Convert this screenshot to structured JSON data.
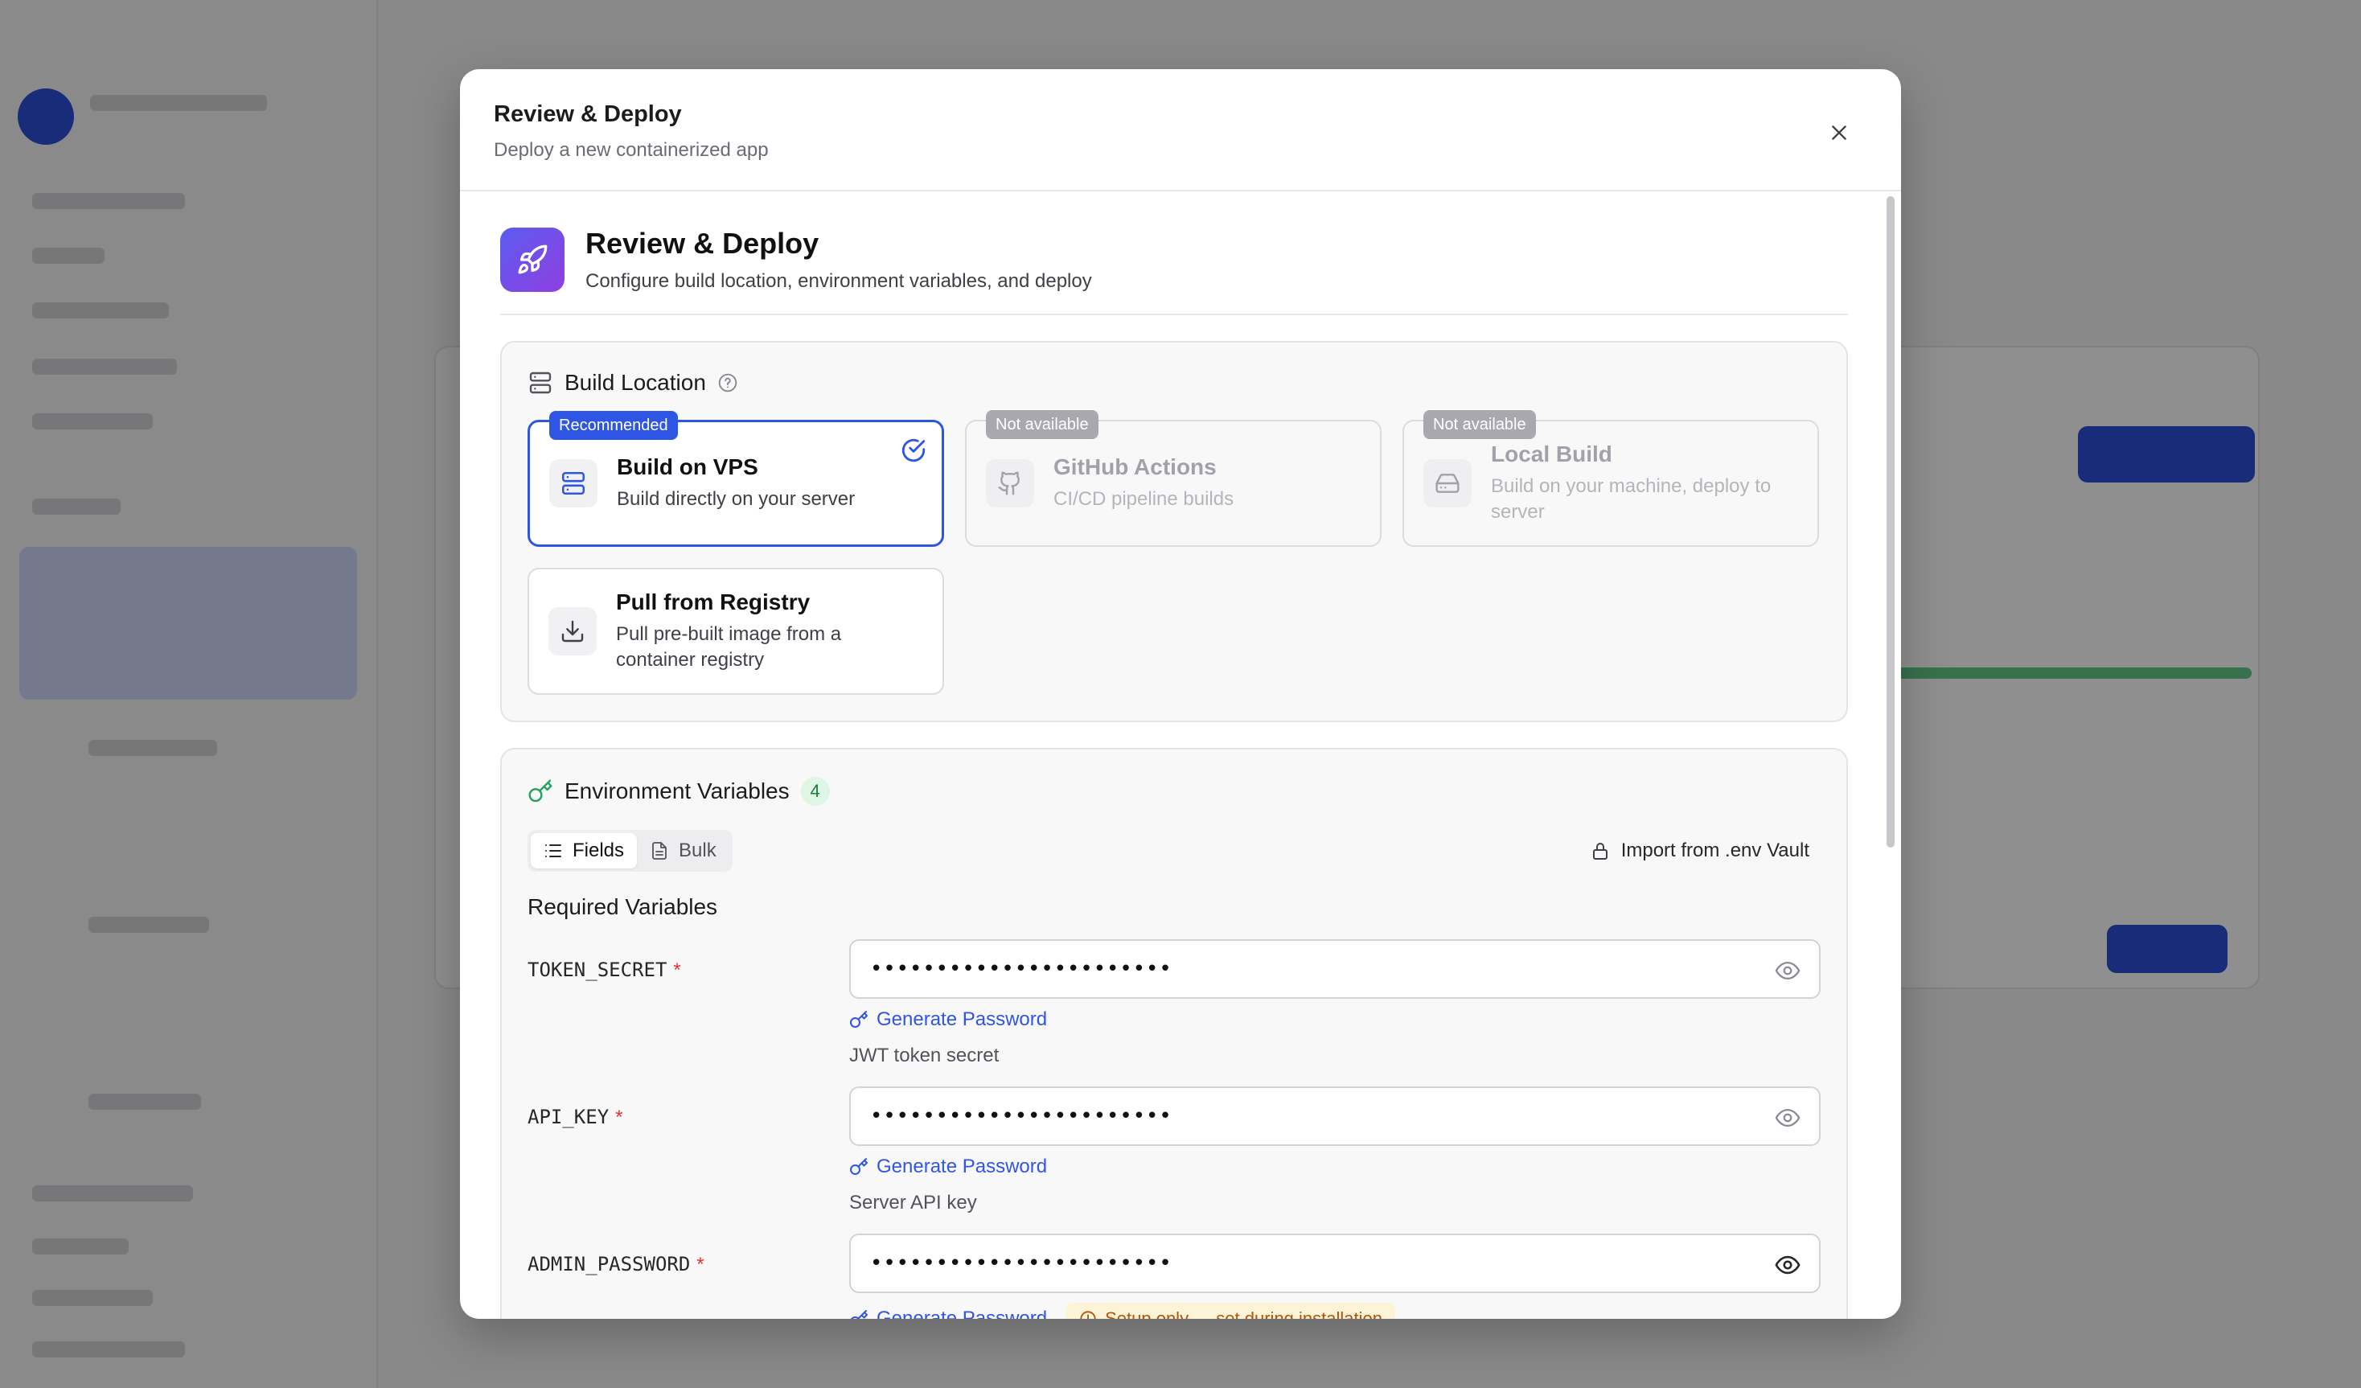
{
  "modal": {
    "title": "Review & Deploy",
    "subtitle": "Deploy a new containerized app"
  },
  "step": {
    "title": "Review & Deploy",
    "description": "Configure build location, environment variables, and deploy"
  },
  "build_location": {
    "heading": "Build Location",
    "options": [
      {
        "name": "Build on VPS",
        "description": "Build directly on your server",
        "tag": "Recommended",
        "selected": true,
        "icon": "server-icon"
      },
      {
        "name": "GitHub Actions",
        "description": "CI/CD pipeline builds",
        "tag": "Not available",
        "disabled": true,
        "icon": "github-icon"
      },
      {
        "name": "Local Build",
        "description": "Build on your machine, deploy to server",
        "tag": "Not available",
        "disabled": true,
        "icon": "hard-drive-icon"
      },
      {
        "name": "Pull from Registry",
        "description": "Pull pre-built image from a container registry",
        "icon": "download-icon"
      }
    ]
  },
  "env": {
    "heading": "Environment Variables",
    "count": "4",
    "tabs": [
      "Fields",
      "Bulk"
    ],
    "active_tab": "Fields",
    "import_label": "Import from .env Vault",
    "required_heading": "Required Variables",
    "variables": [
      {
        "name": "TOKEN_SECRET",
        "required_marker": "*",
        "value": "•••••••••••••••••••••••",
        "generate_label": "Generate Password",
        "hint": "JWT token secret"
      },
      {
        "name": "API_KEY",
        "required_marker": "*",
        "value": "•••••••••••••••••••••••",
        "generate_label": "Generate Password",
        "hint": "Server API key"
      },
      {
        "name": "ADMIN_PASSWORD",
        "required_marker": "*",
        "value": "•••••••••••••••••••••••",
        "generate_label": "Generate Password",
        "badge": "Setup only — set during installation"
      }
    ]
  },
  "colors": {
    "accent": "#2f55e4",
    "required": "#e5332a",
    "count_badge": "#16803c",
    "setup_badge_bg": "#fdf3d6"
  }
}
